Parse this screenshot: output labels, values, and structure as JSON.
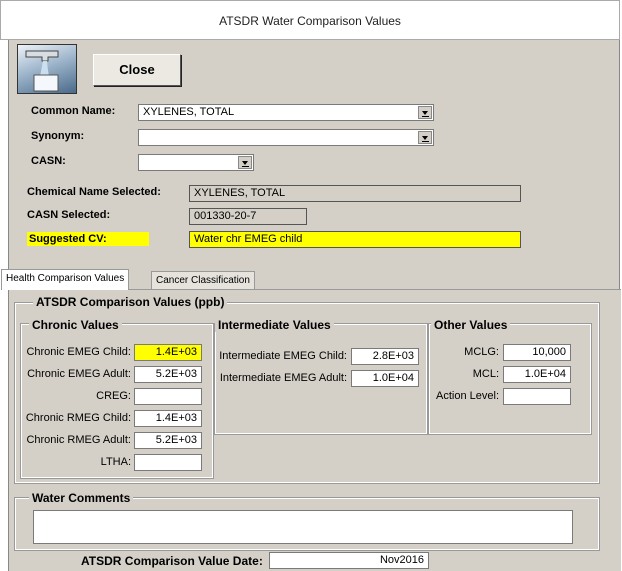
{
  "window": {
    "title": "ATSDR Water Comparison Values"
  },
  "toolbar": {
    "close_label": "Close",
    "logo_icon": "water-faucet-icon"
  },
  "form": {
    "common_name_label": "Common Name:",
    "common_name_value": "XYLENES, TOTAL",
    "synonym_label": "Synonym:",
    "synonym_value": "",
    "casn_label": "CASN:",
    "casn_value": "",
    "chem_selected_label": "Chemical Name Selected:",
    "chem_selected_value": "XYLENES, TOTAL",
    "casn_selected_label": "CASN Selected:",
    "casn_selected_value": "001330-20-7",
    "suggested_cv_label": "Suggested CV:",
    "suggested_cv_value": "Water chr EMEG child"
  },
  "tabs": [
    {
      "label": "Health Comparison Values",
      "active": true
    },
    {
      "label": "Cancer Classification",
      "active": false
    }
  ],
  "health": {
    "group_title": "ATSDR Comparison Values (ppb)",
    "chronic": {
      "title": "Chronic Values",
      "rows": [
        {
          "label": "Chronic EMEG Child:",
          "value": "1.4E+03",
          "highlight": true
        },
        {
          "label": "Chronic EMEG Adult:",
          "value": "5.2E+03"
        },
        {
          "label": "CREG:",
          "value": ""
        },
        {
          "label": "Chronic RMEG Child:",
          "value": "1.4E+03"
        },
        {
          "label": "Chronic RMEG Adult:",
          "value": "5.2E+03"
        },
        {
          "label": "LTHA:",
          "value": ""
        }
      ]
    },
    "intermediate": {
      "title": "Intermediate Values",
      "rows": [
        {
          "label": "Intermediate EMEG Child:",
          "value": "2.8E+03"
        },
        {
          "label": "Intermediate EMEG Adult:",
          "value": "1.0E+04"
        }
      ]
    },
    "other": {
      "title": "Other Values",
      "rows": [
        {
          "label": "MCLG:",
          "value": "10,000"
        },
        {
          "label": "MCL:",
          "value": "1.0E+04"
        },
        {
          "label": "Action Level:",
          "value": ""
        }
      ]
    },
    "comments_title": "Water Comments",
    "comments_value": "",
    "date_label": "ATSDR Comparison Value Date:",
    "date_value": "Nov2016"
  },
  "colors": {
    "highlight": "#ffff00",
    "window_bg": "#d4d0c8"
  }
}
